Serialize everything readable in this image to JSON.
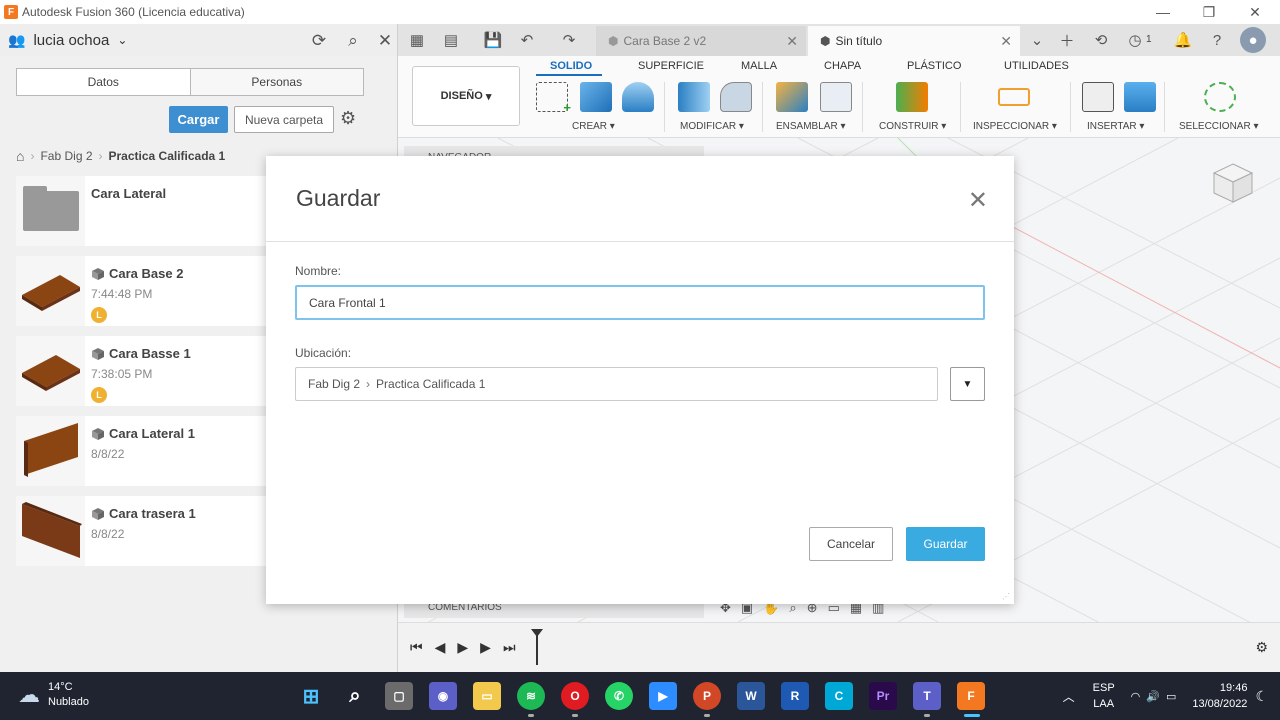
{
  "window": {
    "title": "Autodesk Fusion 360 (Licencia educativa)"
  },
  "datapanel": {
    "user": "lucia ochoa",
    "tabs": [
      "Datos",
      "Personas"
    ],
    "upload_label": "Cargar",
    "new_folder_label": "Nueva carpeta",
    "breadcrumb": [
      "Fab Dig 2",
      "Practica Calificada 1"
    ],
    "files": [
      {
        "name": "Cara Lateral",
        "meta": "",
        "badge": "",
        "kind": "folder"
      },
      {
        "name": "Cara Base 2",
        "meta": "7:44:48 PM",
        "badge": "L",
        "kind": "plank"
      },
      {
        "name": "Cara Basse 1",
        "meta": "7:38:05 PM",
        "badge": "L",
        "kind": "plank"
      },
      {
        "name": "Cara Lateral 1",
        "meta": "8/8/22",
        "badge": "",
        "kind": "plank"
      },
      {
        "name": "Cara trasera 1",
        "meta": "8/8/22",
        "badge": "",
        "kind": "plank"
      }
    ]
  },
  "doctabs": {
    "tab1": "Cara Base 2 v2",
    "tab2": "Sin título",
    "notifications": "1"
  },
  "ribbon": {
    "workspace": "DISEÑO",
    "tabs": [
      "SOLIDO",
      "SUPERFICIE",
      "MALLA",
      "CHAPA",
      "PLÁSTICO",
      "UTILIDADES"
    ],
    "groups": [
      "CREAR",
      "MODIFICAR",
      "ENSAMBLAR",
      "CONSTRUIR",
      "INSPECCIONAR",
      "INSERTAR",
      "SELECCIONAR"
    ]
  },
  "workspace": {
    "navigator": "NAVEGADOR",
    "comments": "COMENTARIOS"
  },
  "dialog": {
    "title": "Guardar",
    "name_label": "Nombre:",
    "name_value": "Cara Frontal 1",
    "location_label": "Ubicación:",
    "location_parts": [
      "Fab Dig 2",
      "Practica Calificada 1"
    ],
    "cancel_label": "Cancelar",
    "save_label": "Guardar"
  },
  "taskbar": {
    "temperature": "14°C",
    "weather": "Nublado",
    "language": "ESP",
    "layout": "LAA",
    "time": "19:46",
    "date": "13/08/2022"
  },
  "colors": {
    "accent": "#39abe0",
    "primary_button": "#3d8fd1",
    "taskbar": "#1f2430"
  }
}
